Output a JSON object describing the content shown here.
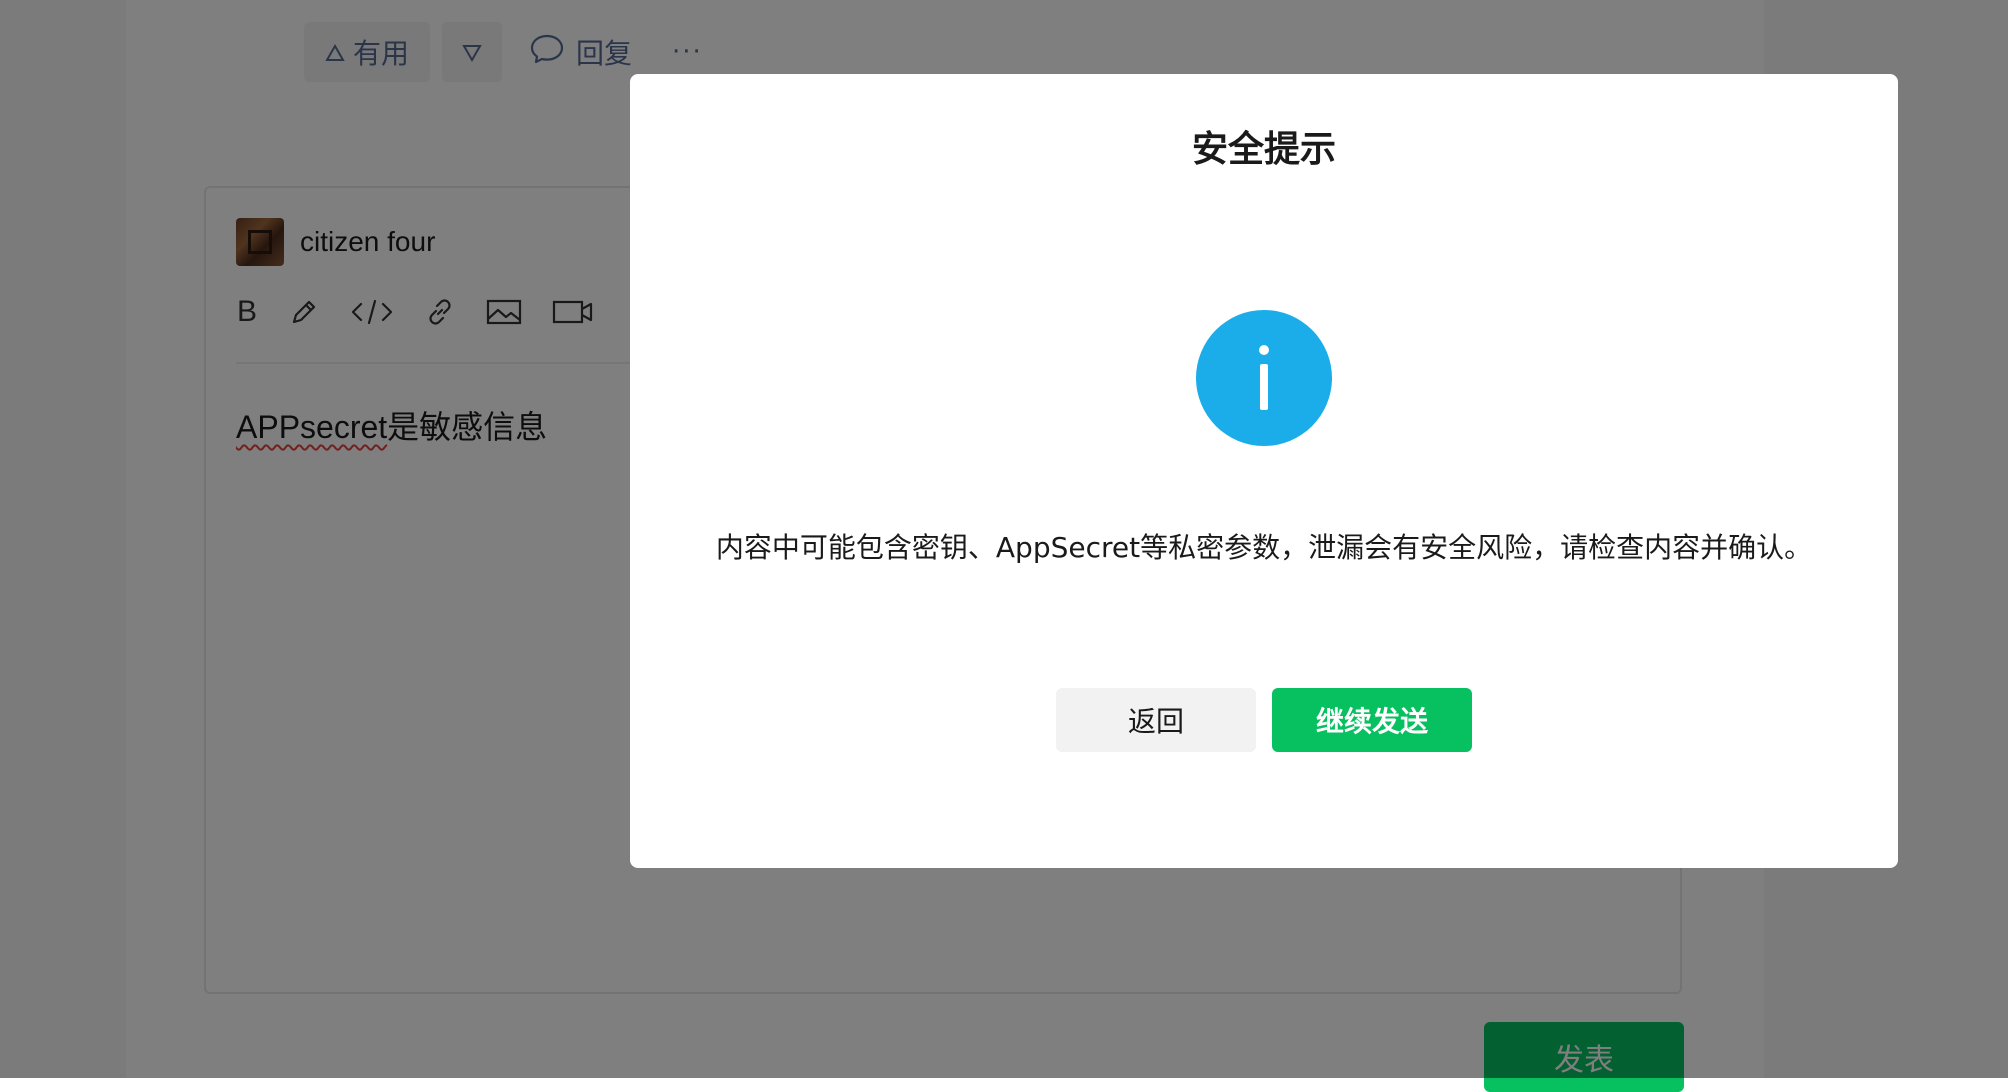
{
  "post_actions": {
    "useful_label": "有用",
    "reply_label": "回复",
    "more_label": "···"
  },
  "editor": {
    "author_name": "citizen four",
    "toolbar": {
      "bold_label": "B",
      "icons": [
        "bold-icon",
        "pen-icon",
        "code-icon",
        "link-icon",
        "image-icon",
        "video-icon"
      ]
    },
    "content_flagged": "APPsecret",
    "content_rest": "是敏感信息"
  },
  "publish": {
    "label": "发表"
  },
  "dialog": {
    "title": "安全提示",
    "icon": "info-icon",
    "message": "内容中可能包含密钥、AppSecret等私密参数，泄漏会有安全风险，请检查内容并确认。",
    "back_label": "返回",
    "continue_label": "继续发送"
  },
  "colors": {
    "accent_green": "#07c160",
    "info_blue": "#1aadea",
    "link_blue": "#576b95",
    "overlay": "rgba(0,0,0,0.5)"
  }
}
